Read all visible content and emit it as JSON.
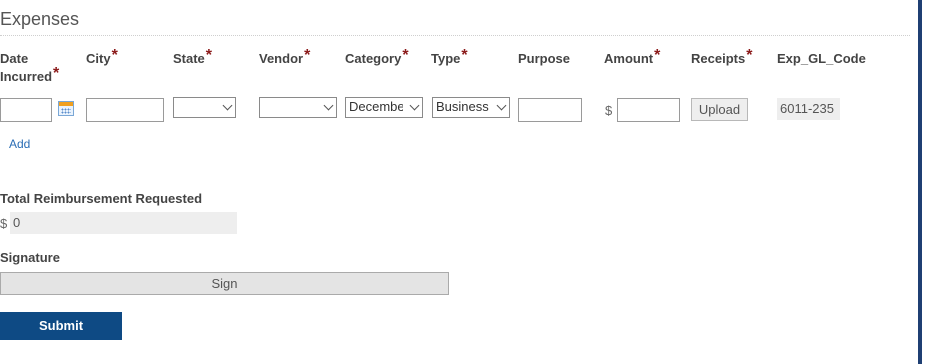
{
  "section": {
    "title": "Expenses"
  },
  "columns": {
    "date": {
      "line1": "Date",
      "line2": "Incurred"
    },
    "city": "City",
    "state": "State",
    "vendor": "Vendor",
    "category": "Category",
    "type": "Type",
    "purpose": "Purpose",
    "amount": "Amount",
    "receipts": "Receipts",
    "gl_code": "Exp_GL_Code"
  },
  "row": {
    "date_value": "",
    "city_value": "",
    "state_selected": "",
    "vendor_selected": "",
    "category_selected": "Decembe",
    "type_selected": "Business",
    "purpose_value": "",
    "amount_currency": "$",
    "amount_value": "",
    "upload_label": "Upload",
    "gl_code_value": "6011-235"
  },
  "add_label": "Add",
  "total": {
    "label": "Total Reimbursement Requested",
    "currency": "$",
    "value": "0"
  },
  "signature": {
    "label": "Signature",
    "button_label": "Sign"
  },
  "submit_label": "Submit",
  "colors": {
    "required": "#8b1a1a",
    "submit_bg": "#0e4a84",
    "link": "#2a6db5",
    "frame": "#1f3f73"
  },
  "icons": {
    "calendar": "calendar-icon",
    "required": "asterisk"
  }
}
